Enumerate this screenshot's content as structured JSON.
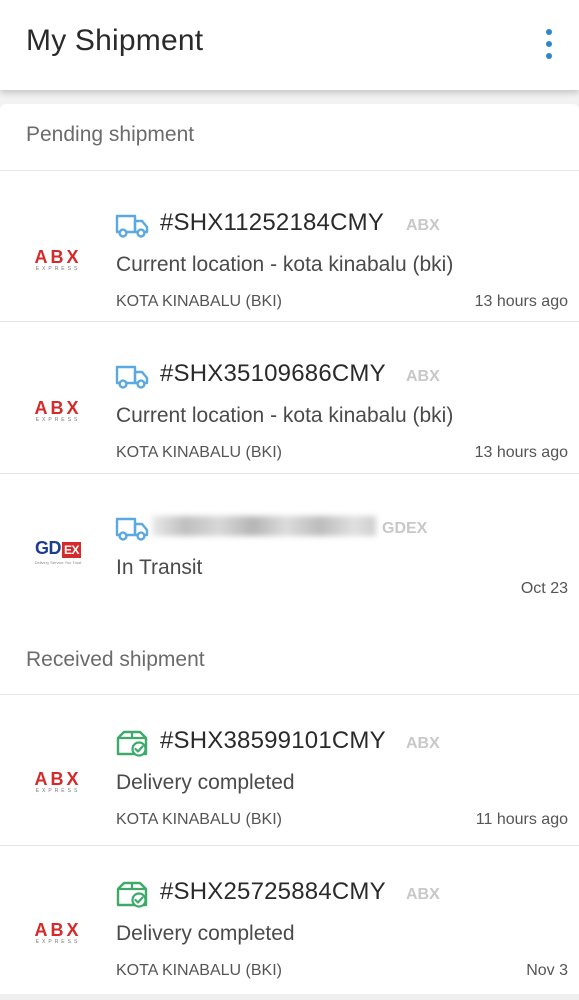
{
  "header": {
    "title": "My Shipment",
    "menu_icon": "more-vert-icon"
  },
  "sections": {
    "pending": "Pending shipment",
    "received": "Received shipment"
  },
  "shipments": [
    {
      "tracking": "#SHX11252184CMY",
      "carrier": "ABX",
      "status": "Current location - kota kinabalu (bki)",
      "location": "KOTA KINABALU (BKI)",
      "time": "13 hours ago",
      "logo": "ABX",
      "logo_sub": "EXPRESS",
      "icon": "truck-icon"
    },
    {
      "tracking": "#SHX35109686CMY",
      "carrier": "ABX",
      "status": "Current location - kota kinabalu (bki)",
      "location": "KOTA KINABALU (BKI)",
      "time": "13 hours ago",
      "logo": "ABX",
      "logo_sub": "EXPRESS",
      "icon": "truck-icon"
    },
    {
      "tracking": "",
      "carrier": "GDEX",
      "status": "In Transit",
      "location": "",
      "time": "Oct 23",
      "logo": "GD",
      "logo_ex": "EX",
      "logo_sub": "Delivery Service You Trust",
      "icon": "truck-icon"
    },
    {
      "tracking": "#SHX38599101CMY",
      "carrier": "ABX",
      "status": "Delivery completed",
      "location": "KOTA KINABALU (BKI)",
      "time": "11 hours ago",
      "logo": "ABX",
      "logo_sub": "EXPRESS",
      "icon": "package-check-icon"
    },
    {
      "tracking": "#SHX25725884CMY",
      "carrier": "ABX",
      "status": "Delivery completed",
      "location": "KOTA KINABALU (BKI)",
      "time": "Nov 3",
      "logo": "ABX",
      "logo_sub": "EXPRESS",
      "icon": "package-check-icon"
    }
  ],
  "colors": {
    "accent": "#2f86c9",
    "truck": "#5aa9e0",
    "delivered": "#3daa6a",
    "logo_red": "#d52a2a",
    "gdex_blue": "#1d3d8f"
  }
}
